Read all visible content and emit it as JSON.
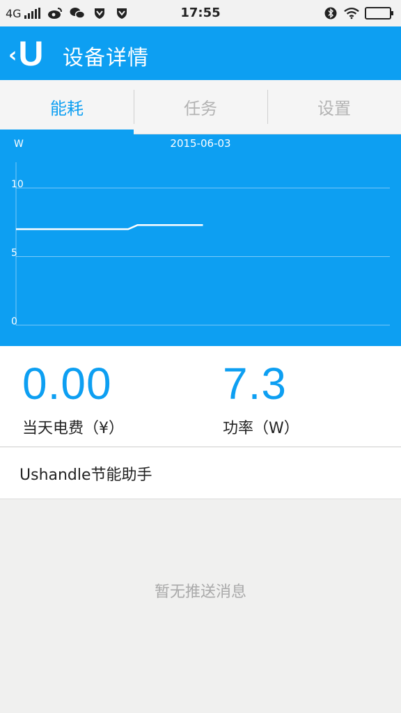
{
  "status_bar": {
    "network": "4G",
    "time": "17:55",
    "icons": [
      "signal-icon",
      "weibo-icon",
      "wechat-icon",
      "shield-icon",
      "shield-icon",
      "bluetooth-icon",
      "wifi-icon",
      "battery-icon"
    ]
  },
  "header": {
    "title": "设备详情",
    "logo_text": "U",
    "back_glyph": "‹",
    "background_color": "#0d9ff2"
  },
  "tabs": [
    {
      "label": "能耗",
      "active": true
    },
    {
      "label": "任务",
      "active": false
    },
    {
      "label": "设置",
      "active": false
    }
  ],
  "chart_data": {
    "type": "line",
    "title": "2015-06-03",
    "xlabel": "",
    "ylabel": "W",
    "ylim": [
      0,
      10
    ],
    "yticks": [
      0,
      5,
      10
    ],
    "grid": true,
    "series": [
      {
        "x": [
          0,
          0.6,
          0.65,
          1.0
        ],
        "y": [
          7.0,
          7.0,
          7.3,
          7.3
        ]
      }
    ],
    "xlim": [
      0,
      2
    ]
  },
  "stats": {
    "cost_value": "0.00",
    "cost_label": "当天电费（¥）",
    "power_value": "7.3",
    "power_label": "功率（W）"
  },
  "message": {
    "row_label": "Ushandle节能助手",
    "empty_text": "暂无推送消息"
  }
}
